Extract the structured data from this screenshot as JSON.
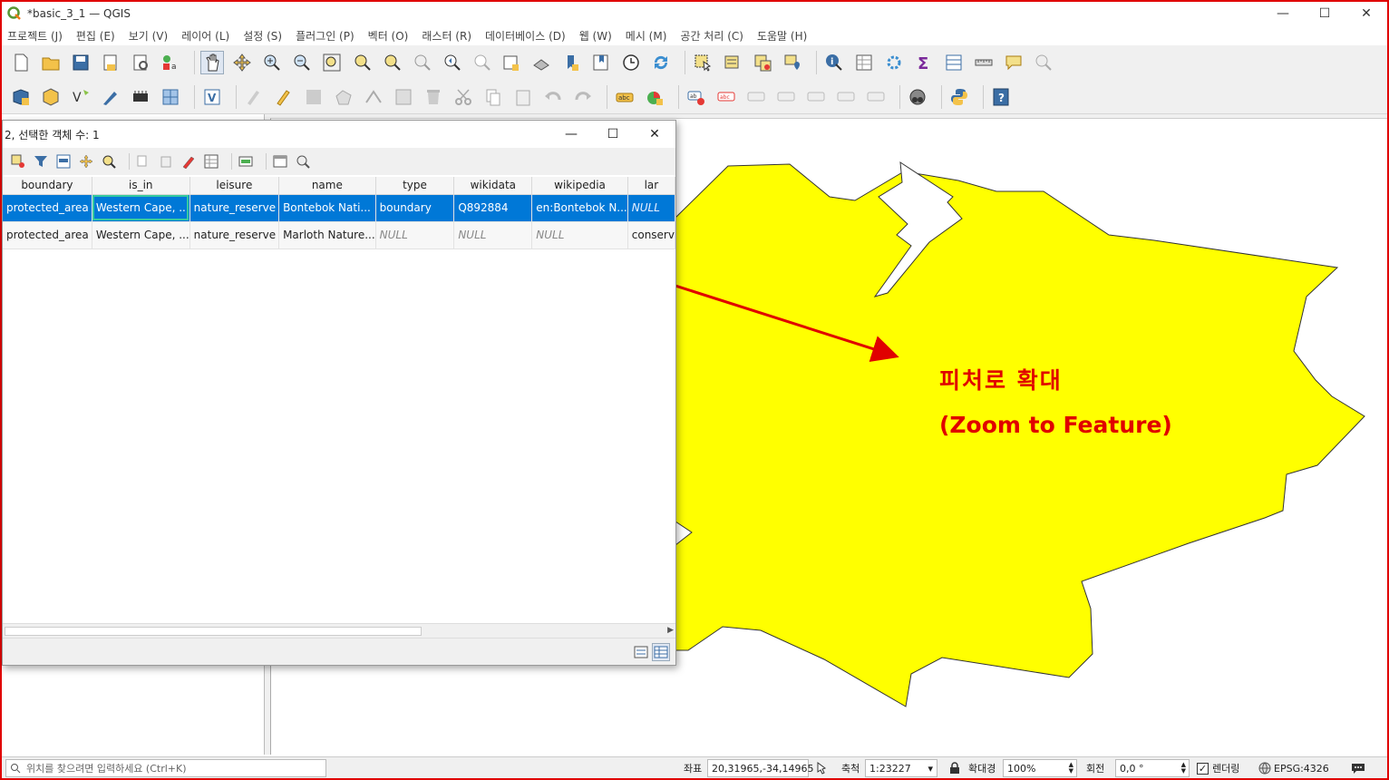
{
  "window": {
    "title": "*basic_3_1 — QGIS",
    "minimize": "—",
    "maximize": "☐",
    "close": "✕"
  },
  "menu": [
    "프로젝트 (J)",
    "편집 (E)",
    "보기 (V)",
    "레이어 (L)",
    "설정 (S)",
    "플러그인 (P)",
    "벡터 (O)",
    "래스터 (R)",
    "데이터베이스 (D)",
    "웹 (W)",
    "메시 (M)",
    "공간 처리 (C)",
    "도움말 (H)"
  ],
  "attribute_table": {
    "title": "2, 선택한 객체 수: 1",
    "columns": [
      "boundary",
      "is_in",
      "leisure",
      "name",
      "type",
      "wikidata",
      "wikipedia",
      "lar"
    ],
    "rows": [
      [
        "protected_area",
        "Western Cape, ...",
        "nature_reserve",
        "Bontebok Nati...",
        "boundary",
        "Q892884",
        "en:Bontebok N...",
        "NULL"
      ],
      [
        "protected_area",
        "Western Cape, ...",
        "nature_reserve",
        "Marloth Nature...",
        "NULL",
        "NULL",
        "NULL",
        "conserv"
      ]
    ]
  },
  "annotation": {
    "line1": "피처로 확대",
    "line2": "(Zoom to Feature)",
    "color": "#e00000"
  },
  "map": {
    "feature_fill": "#ffff00"
  },
  "status": {
    "locator_placeholder": "위치를 찾으려면 입력하세요 (Ctrl+K)",
    "coord_label": "좌표",
    "coord_value": "20,31965,-34,14965",
    "scale_label": "축척",
    "scale_value": "1:23227",
    "magnifier_label": "확대경",
    "magnifier_value": "100%",
    "rotation_label": "회전",
    "rotation_value": "0,0 °",
    "render_label": "렌더링",
    "crs": "EPSG:4326"
  }
}
